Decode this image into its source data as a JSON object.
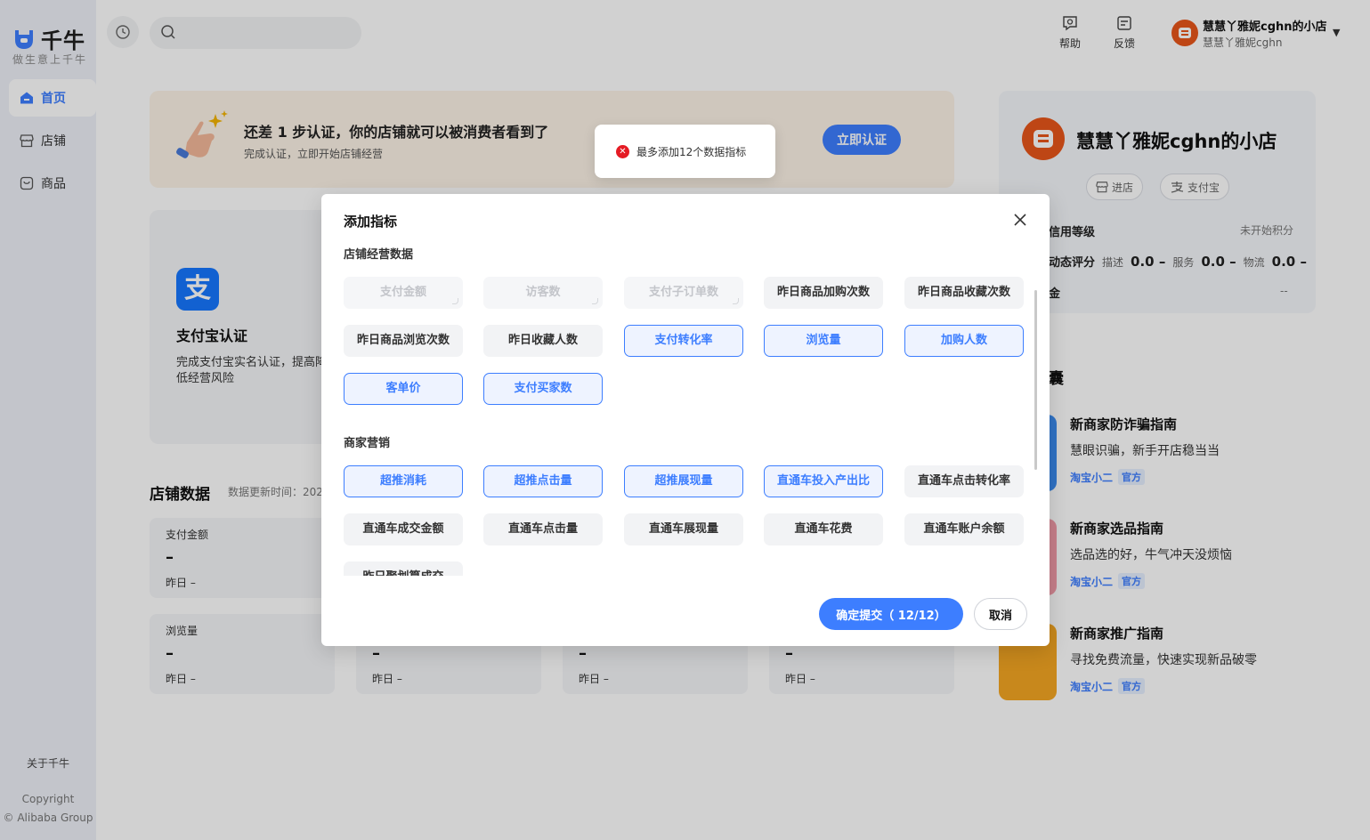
{
  "app": {
    "logo_text": "千牛",
    "logo_sub": "做生意上千牛"
  },
  "sidebar": {
    "items": [
      {
        "label": "首页",
        "icon": "home-icon",
        "active": true
      },
      {
        "label": "店铺",
        "icon": "store-icon",
        "active": false
      },
      {
        "label": "商品",
        "icon": "product-icon",
        "active": false
      }
    ],
    "about": "关于千牛",
    "copyright_1": "Copyright",
    "copyright_2": "© Alibaba Group"
  },
  "topbar": {
    "search_placeholder": "",
    "help": "帮助",
    "feedback": "反馈",
    "user_name": "慧慧丫雅妮cghn的小店",
    "user_sub": "慧慧丫雅妮cghn"
  },
  "banner": {
    "title": "还差 1 步认证，你的店铺就可以被消费者看到了",
    "subtitle": "完成认证，立即开始店铺经营",
    "button": "立即认证"
  },
  "alipay_card": {
    "logo": "支",
    "title": "支付宝认证",
    "desc": "完成支付宝实名认证，提高降低经营风险"
  },
  "store_data": {
    "title": "店铺数据",
    "update_time": "数据更新时间：202",
    "stats_row1": [
      {
        "label": "支付金额",
        "value": "–",
        "prev": "昨日 –"
      }
    ],
    "stats_row2": [
      {
        "label": "浏览量",
        "value": "–",
        "prev": "昨日 –"
      },
      {
        "label": "",
        "value": "–",
        "prev": "昨日 –"
      },
      {
        "label": "",
        "value": "–",
        "prev": "昨日 –"
      },
      {
        "label": "",
        "value": "–",
        "prev": "昨日 –"
      }
    ]
  },
  "shop_panel": {
    "name": "慧慧丫雅妮cghn的小店",
    "enter_shop": "进店",
    "alipay": "支付宝",
    "credit_label": "信用等级",
    "credit_value": "未开始积分",
    "dsr_label": "动态评分",
    "dsr_desc": "描述",
    "dsr_desc_val": "0.0 –",
    "dsr_service": "服务",
    "dsr_service_val": "0.0 –",
    "dsr_logistics": "物流",
    "dsr_logistics_val": "0.0 –",
    "deposit_label": "金",
    "deposit_value": "--",
    "kit_title": "囊"
  },
  "guides": [
    {
      "title": "新商家防诈骗指南",
      "desc": "慧眼识骗，新手开店稳当当",
      "author": "淘宝小二",
      "badge": "官方",
      "color": "#3b8cf0"
    },
    {
      "title": "新商家选品指南",
      "desc": "选品选的好，牛气冲天没烦恼",
      "author": "淘宝小二",
      "badge": "官方",
      "color": "#f29aa8"
    },
    {
      "title": "新商家推广指南",
      "desc": "寻找免费流量，快速实现新品破零",
      "author": "淘宝小二",
      "badge": "官方",
      "color": "#f5a623"
    }
  ],
  "toast": {
    "message": "最多添加12个数据指标"
  },
  "modal": {
    "title": "添加指标",
    "group1_title": "店铺经营数据",
    "group1": [
      {
        "label": "支付金额",
        "state": "disabled"
      },
      {
        "label": "访客数",
        "state": "disabled"
      },
      {
        "label": "支付子订单数",
        "state": "disabled"
      },
      {
        "label": "昨日商品加购次数",
        "state": "normal"
      },
      {
        "label": "昨日商品收藏次数",
        "state": "normal"
      },
      {
        "label": "昨日商品浏览次数",
        "state": "normal"
      },
      {
        "label": "昨日收藏人数",
        "state": "normal"
      },
      {
        "label": "支付转化率",
        "state": "selected"
      },
      {
        "label": "浏览量",
        "state": "selected"
      },
      {
        "label": "加购人数",
        "state": "selected"
      },
      {
        "label": "客单价",
        "state": "selected"
      },
      {
        "label": "支付买家数",
        "state": "selected"
      }
    ],
    "group2_title": "商家营销",
    "group2": [
      {
        "label": "超推消耗",
        "state": "selected"
      },
      {
        "label": "超推点击量",
        "state": "selected"
      },
      {
        "label": "超推展现量",
        "state": "selected"
      },
      {
        "label": "直通车投入产出比",
        "state": "selected"
      },
      {
        "label": "直通车点击转化率",
        "state": "normal"
      },
      {
        "label": "直通车成交金额",
        "state": "normal"
      },
      {
        "label": "直通车点击量",
        "state": "normal"
      },
      {
        "label": "直通车展现量",
        "state": "normal"
      },
      {
        "label": "直通车花费",
        "state": "normal"
      },
      {
        "label": "直通车账户余额",
        "state": "normal"
      },
      {
        "label": "昨日聚划算成交",
        "state": "normal"
      }
    ],
    "submit": "确定提交（ 12/12）",
    "cancel": "取消"
  },
  "colors": {
    "accent": "#3d7eff",
    "error": "#e51b24",
    "brand_orange": "#e8561a"
  }
}
